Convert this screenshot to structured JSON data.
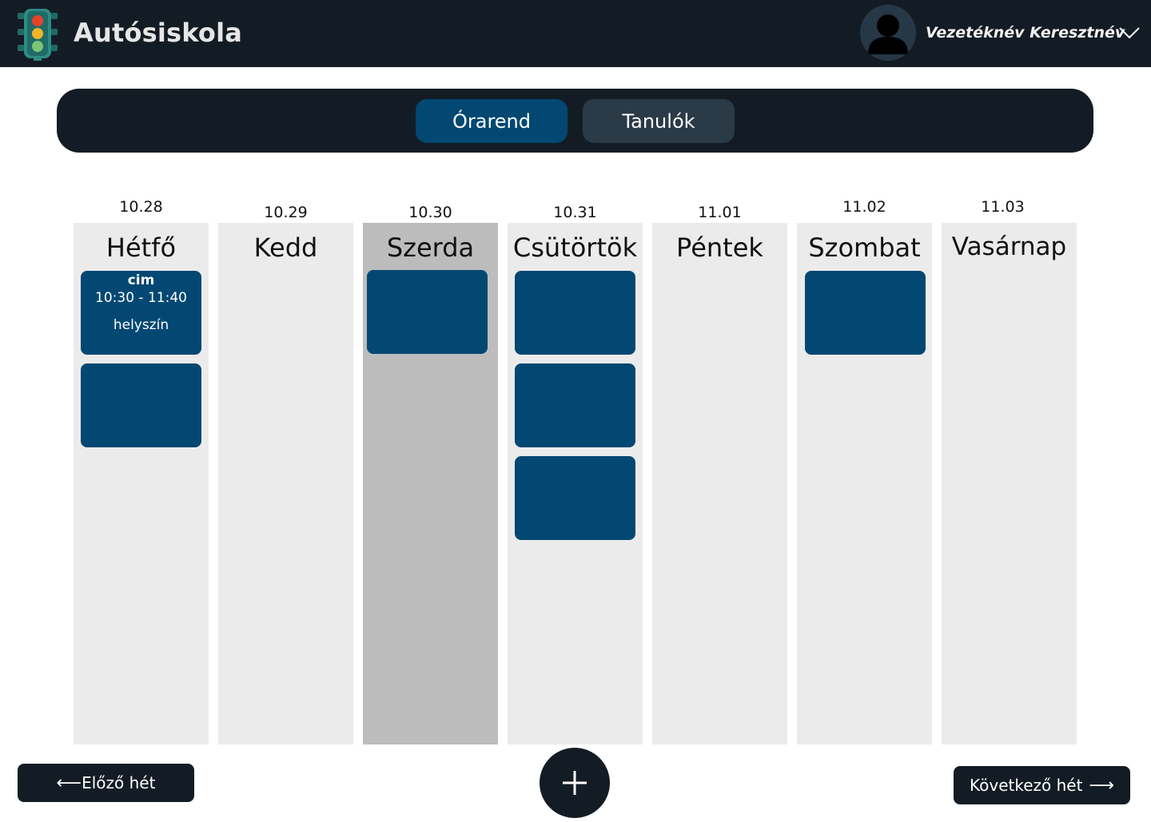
{
  "header": {
    "app_title": "Autósiskola",
    "user_name": "Vezetéknév Keresztnév"
  },
  "tabs": [
    {
      "label": "Órarend",
      "active": true
    },
    {
      "label": "Tanulók",
      "active": false
    }
  ],
  "days": [
    {
      "date": "10.28",
      "name": "Hétfő"
    },
    {
      "date": "10.29",
      "name": "Kedd"
    },
    {
      "date": "10.30",
      "name": "Szerda"
    },
    {
      "date": "10.31",
      "name": "Csütörtök"
    },
    {
      "date": "11.01",
      "name": "Péntek"
    },
    {
      "date": "11.02",
      "name": "Szombat"
    },
    {
      "date": "11.03",
      "name": "Vasárnap"
    }
  ],
  "today_index": 2,
  "event_detail": {
    "title": "cim",
    "time": "10:30 - 11:40",
    "location": "helyszín"
  },
  "events_per_day": [
    2,
    0,
    1,
    3,
    0,
    1,
    0
  ],
  "navigation": {
    "prev_label": "Előző hét",
    "next_label": "Következő hét",
    "prev_arrow": "⟵",
    "next_arrow": "⟶"
  },
  "icons": {
    "logo": "traffic-light-icon",
    "avatar": "user-silhouette-icon",
    "dropdown": "chevron-down-icon",
    "add": "plus-icon"
  },
  "colors": {
    "header_bg": "#131c24",
    "accent": "#024872",
    "tab_inactive": "#2a3a47",
    "column_bg": "#ebebeb",
    "column_today_bg": "#bcbcbc"
  }
}
